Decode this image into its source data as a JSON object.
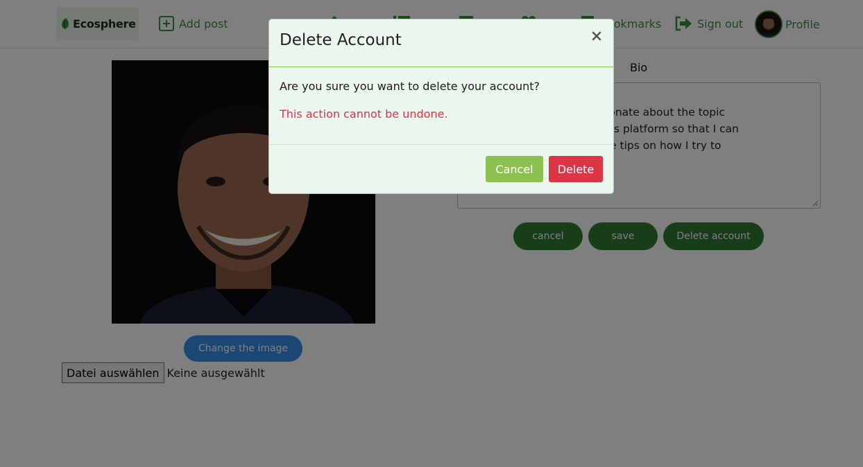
{
  "navbar": {
    "brand": "Ecosphere",
    "add_post": "Add post",
    "bookmarks": "Bookmarks",
    "sign_out": "Sign out",
    "profile": "Profile",
    "icons": [
      "leaf-logo-icon",
      "plus-square-icon",
      "home-icon",
      "list-icon",
      "chat-icon",
      "heart-icon",
      "bookmark-icon",
      "sign-out-icon"
    ]
  },
  "profile_page": {
    "change_image": "Change the image",
    "file_button": "Datei auswählen",
    "file_status": "Keine ausgewählt",
    "bio_label": "Bio",
    "bio_text": "                                  assionate about the topic\n                           I joined this platform so that I can\n                          c and share tips on how I try to\n                          nt",
    "cancel": "cancel",
    "save": "save",
    "delete_account": "Delete account"
  },
  "modal": {
    "title": "Delete Account",
    "question": "Are you sure you want to delete your account?",
    "warning": "This action cannot be undone.",
    "cancel": "Cancel",
    "delete": "Delete"
  },
  "colors": {
    "primary_green": "#3b8f3b",
    "dark_green": "#2e7d32",
    "light_green": "#8cc152",
    "danger": "#dc3545",
    "blue": "#3a8ee6",
    "modal_bg": "#eaf6ee"
  }
}
